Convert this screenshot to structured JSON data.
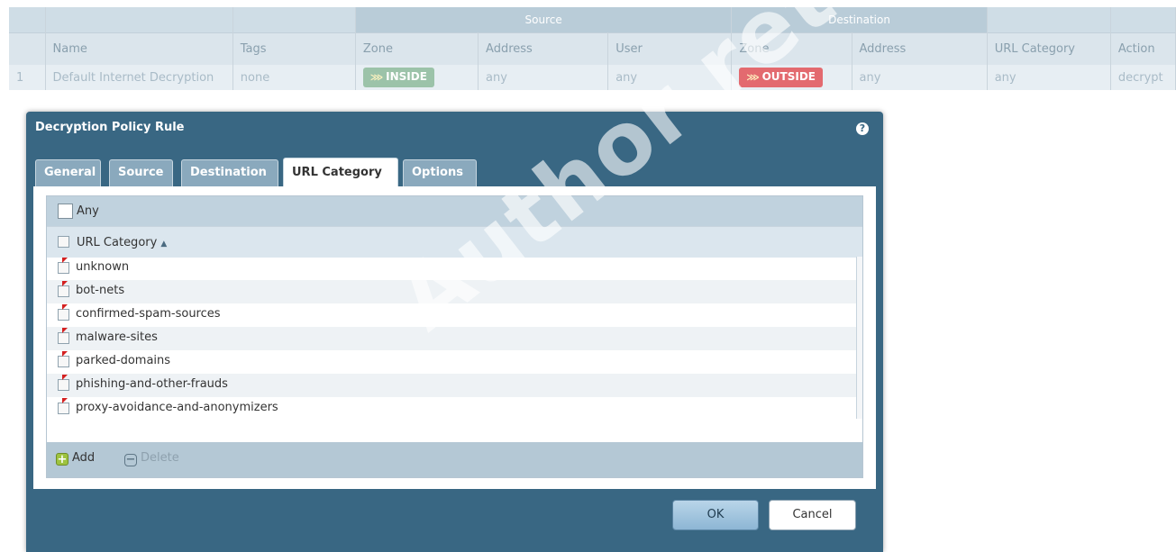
{
  "policy_table": {
    "group_headers": {
      "source": "Source",
      "destination": "Destination"
    },
    "columns": [
      "Name",
      "Tags",
      "Zone",
      "Address",
      "User",
      "Zone",
      "Address",
      "URL Category",
      "Action"
    ],
    "row": {
      "index": "1",
      "name": "Default Internet Decryption",
      "tags": "none",
      "src_zone": "INSIDE",
      "src_address": "any",
      "user": "any",
      "dst_zone": "OUTSIDE",
      "dst_address": "any",
      "url_category": "any",
      "action": "decrypt"
    }
  },
  "dialog": {
    "title": "Decryption Policy Rule",
    "help_icon": "?",
    "tabs": [
      {
        "label": "General",
        "active": false
      },
      {
        "label": "Source",
        "active": false
      },
      {
        "label": "Destination",
        "active": false
      },
      {
        "label": "URL Category",
        "active": true
      },
      {
        "label": "Options",
        "active": false
      }
    ],
    "any_label": "Any",
    "column_header": "URL Category",
    "sort_indicator": "▲",
    "categories": [
      "unknown",
      "bot-nets",
      "confirmed-spam-sources",
      "malware-sites",
      "parked-domains",
      "phishing-and-other-frauds",
      "proxy-avoidance-and-anonymizers"
    ],
    "add_label": "Add",
    "delete_label": "Delete",
    "ok_label": "OK",
    "cancel_label": "Cancel"
  },
  "watermark": "Author retains full rights",
  "colors": {
    "dialog_bg": "#396783",
    "zone_inside": "#9cc3a9",
    "zone_outside": "#e36a6f",
    "add_icon": "#9ec33f",
    "changed_flag": "#d42020"
  }
}
